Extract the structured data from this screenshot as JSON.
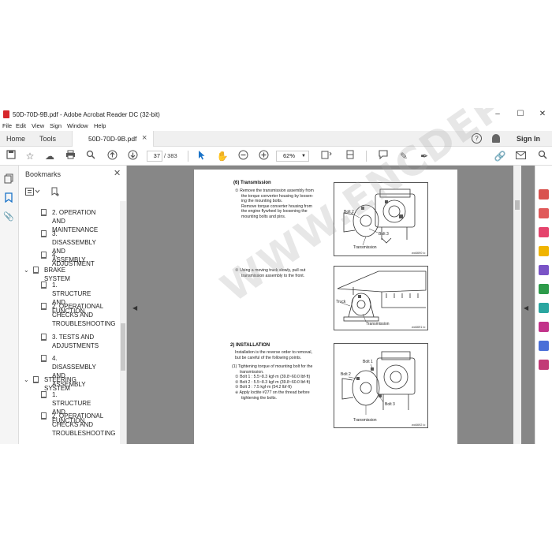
{
  "window": {
    "title": "50D-70D-9B.pdf - Adobe Acrobat Reader DC (32-bit)",
    "controls": [
      "–",
      "☐",
      "✕"
    ]
  },
  "menu": [
    "File",
    "Edit",
    "View",
    "Sign",
    "Window",
    "Help"
  ],
  "tabs": {
    "home": "Home",
    "tools": "Tools",
    "document": "50D-70D-9B.pdf",
    "close": "×",
    "help": "?",
    "signin": "Sign In"
  },
  "toolbar": {
    "page_current": "37",
    "page_total": "/ 383",
    "zoom": "62%",
    "icons": [
      "save-icon",
      "bookmark-star-icon",
      "cloud-upload-icon",
      "print-icon",
      "search-icon",
      "prev-page-icon",
      "next-page-icon",
      "select-cursor-icon",
      "hand-icon",
      "zoom-out-icon",
      "zoom-in-icon",
      "page-fit-icon",
      "scroll-mode-icon",
      "comment-icon",
      "highlight-icon",
      "sign-icon",
      "share-link-icon",
      "email-icon",
      "search-right-icon"
    ]
  },
  "bookmarks": {
    "header": "Bookmarks",
    "close": "✕",
    "items": [
      {
        "label": "2. OPERATION AND",
        "label2": "MAINTENANCE",
        "level": 2
      },
      {
        "label": "3. DISASSEMBLY",
        "label2": "AND ASSEMBLY",
        "level": 2
      },
      {
        "label": "4. ADJUSTMENT",
        "label2": "",
        "level": 2
      },
      {
        "label": "BRAKE SYSTEM",
        "label2": "",
        "level": 1
      },
      {
        "label": "1. STRUCTURE AND",
        "label2": "FUNCTION",
        "level": 2
      },
      {
        "label": "2. OPERATIONAL",
        "label2": "CHECKS AND",
        "label3": "TROUBLESHOOTING",
        "level": 2
      },
      {
        "label": "3. TESTS AND",
        "label2": "ADJUSTMENTS",
        "level": 2
      },
      {
        "label": "4. DISASSEMBLY",
        "label2": "AND ASSEMBLY",
        "level": 2
      },
      {
        "label": "STEERING SYSTEM",
        "label2": "",
        "level": 1
      },
      {
        "label": "1. STRUCTURE AND",
        "label2": "FUNCTION",
        "level": 2
      },
      {
        "label": "2. OPERATIONAL",
        "label2": "CHECKS AND",
        "label3": "TROUBLESHOOTING",
        "level": 2
      }
    ]
  },
  "document": {
    "section1_title": "(6) Transmission",
    "step1": [
      "① Remove the transmission assembly from",
      "the torque converter housing by loosen-",
      "ing the mounting bolts.",
      "Remove torque converter housing from",
      "the engine flywheel by loosening the",
      "mounting bolts and pins."
    ],
    "fig1": {
      "labels": [
        "Bolt 2",
        "Bolt 3",
        "Transmission"
      ],
      "code": "wd4690 lo"
    },
    "step2": [
      "② Using a moving truck slowly, pull out",
      "transmission assembly to the front."
    ],
    "fig2": {
      "labels": [
        "Truck",
        "Transmission"
      ],
      "code": "wd4691 lo"
    },
    "section2_title": "2) INSTALLATION",
    "install_intro": [
      "Installation is the reverse order to removal,",
      "but be careful of the following points."
    ],
    "install_steps": [
      "(1) Tightening torque of mounting bolt for the",
      "transmission.",
      "① Bolt 1 : 5.5~8.3 kgf·m (39.8~60.0 lbf·ft)",
      "② Bolt 2 : 5.5~8.3 kgf·m (39.8~60.0 lbf·ft)",
      "③ Bolt 3 : 7.5 kgf·m (54.2 lbf·ft)",
      "※ Apply loctite #277 on the thread before",
      "tightening the bolts."
    ],
    "fig3": {
      "labels": [
        "Bolt 1",
        "Bolt 2",
        "Bolt 3",
        "Transmission"
      ],
      "code": "wd4692 lo"
    }
  },
  "watermark": "WWW.ENCDEPO.COM",
  "colors": {
    "accent": "#1a73c8",
    "pdf_red": "#d6262b",
    "doc_bg": "#878787"
  }
}
